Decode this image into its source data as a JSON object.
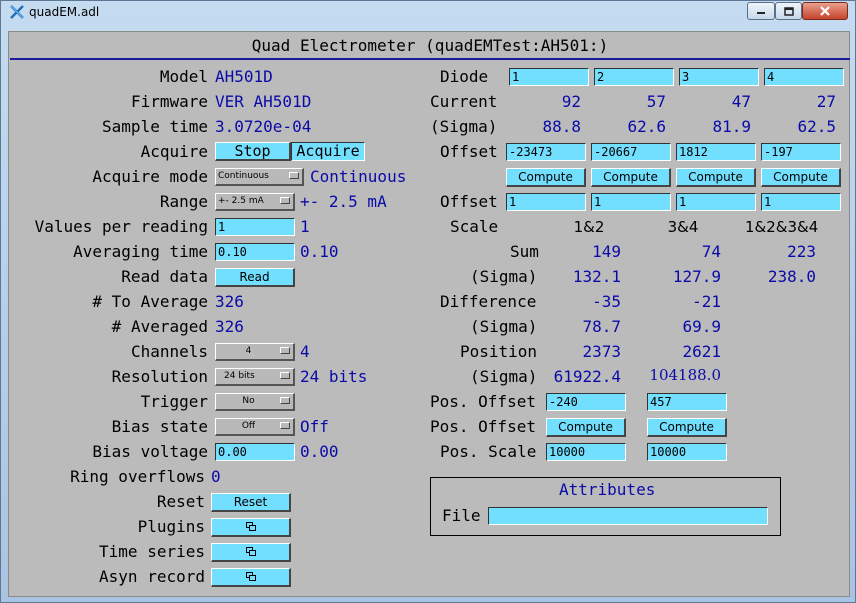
{
  "window": {
    "title": "quadEM.adl"
  },
  "header": {
    "title": "Quad Electrometer (quadEMTest:AH501:)"
  },
  "left": {
    "model": {
      "label": "Model",
      "value": "AH501D"
    },
    "firmware": {
      "label": "Firmware",
      "value": "VER AH501D"
    },
    "sample_time": {
      "label": "Sample time",
      "value": "3.0720e-04"
    },
    "acquire": {
      "label": "Acquire",
      "stop": "Stop",
      "acquire": "Acquire"
    },
    "acquire_mode": {
      "label": "Acquire mode",
      "menu": "Continuous",
      "value": "Continuous"
    },
    "range": {
      "label": "Range",
      "menu": "+- 2.5 mA",
      "value": "+- 2.5 mA"
    },
    "values_per_reading": {
      "label": "Values per reading",
      "input": "1",
      "value": "1"
    },
    "averaging_time": {
      "label": "Averaging time",
      "input": "0.10",
      "value": "0.10"
    },
    "read_data": {
      "label": "Read data",
      "button": "Read"
    },
    "to_average": {
      "label": "# To Average",
      "value": "326"
    },
    "averaged": {
      "label": "# Averaged",
      "value": "326"
    },
    "channels": {
      "label": "Channels",
      "menu": "4",
      "value": "4"
    },
    "resolution": {
      "label": "Resolution",
      "menu": "24 bits",
      "value": "24 bits"
    },
    "trigger": {
      "label": "Trigger",
      "menu": "No"
    },
    "bias_state": {
      "label": "Bias state",
      "menu": "Off",
      "value": "Off"
    },
    "bias_voltage": {
      "label": "Bias voltage",
      "input": "0.00",
      "value": "0.00"
    },
    "ring_overflows": {
      "label": "Ring overflows",
      "value": "0"
    },
    "reset": {
      "label": "Reset",
      "button": "Reset"
    },
    "plugins": {
      "label": "Plugins"
    },
    "time_series": {
      "label": "Time series"
    },
    "asyn_record": {
      "label": "Asyn record"
    }
  },
  "right": {
    "diode": {
      "label": "Diode",
      "inputs": [
        "1",
        "2",
        "3",
        "4"
      ]
    },
    "current": {
      "label": "Current",
      "values": [
        "92",
        "57",
        "47",
        "27"
      ]
    },
    "current_sigma": {
      "label": "(Sigma)",
      "values": [
        "88.8",
        "62.6",
        "81.9",
        "62.5"
      ]
    },
    "offset": {
      "label": "Offset",
      "inputs": [
        "-23473",
        "-20667",
        "1812",
        "-197"
      ]
    },
    "compute": {
      "labels": [
        "Compute",
        "Compute",
        "Compute",
        "Compute"
      ]
    },
    "offset2": {
      "label": "Offset",
      "inputs": [
        "1",
        "1",
        "1",
        "1"
      ]
    },
    "scale": {
      "label": "Scale",
      "headers": [
        "1&2",
        "3&4",
        "1&2&3&4"
      ]
    },
    "sum": {
      "label": "Sum",
      "values": [
        "149",
        "74",
        "223"
      ]
    },
    "sum_sigma": {
      "label": "(Sigma)",
      "values": [
        "132.1",
        "127.9",
        "238.0"
      ]
    },
    "difference": {
      "label": "Difference",
      "values": [
        "-35",
        "-21"
      ]
    },
    "difference_sigma": {
      "label": "(Sigma)",
      "values": [
        "78.7",
        "69.9"
      ]
    },
    "position": {
      "label": "Position",
      "values": [
        "2373",
        "2621"
      ]
    },
    "position_sigma": {
      "label": "(Sigma)",
      "values": [
        "61922.4",
        "104188.0"
      ]
    },
    "pos_offset": {
      "label": "Pos. Offset",
      "inputs": [
        "-240",
        "457"
      ]
    },
    "pos_offset_compute": {
      "label": "Pos. Offset",
      "buttons": [
        "Compute",
        "Compute"
      ]
    },
    "pos_scale": {
      "label": "Pos. Scale",
      "inputs": [
        "10000",
        "10000"
      ]
    },
    "attributes": {
      "title": "Attributes",
      "file_label": "File",
      "file_value": ""
    }
  },
  "icons": {
    "app": "x-logo-icon",
    "related_display": "related-display-icon"
  },
  "colors": {
    "input_bg": "#73dfff",
    "value_text": "#0a0aa8",
    "panel_bg": "#bbbbbb",
    "rule": "#1a1aa0"
  }
}
